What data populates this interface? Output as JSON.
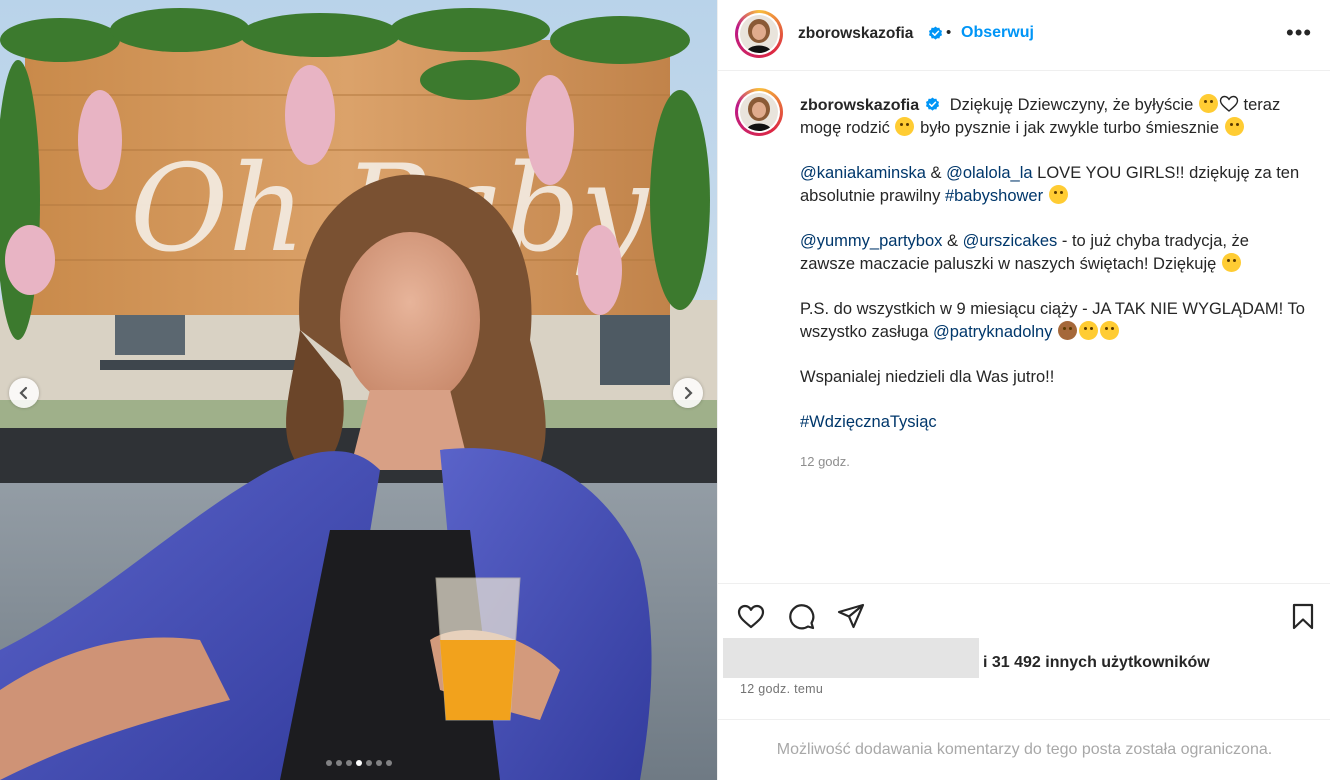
{
  "post": {
    "username": "zborowskazofia",
    "separator": "•",
    "follow_label": "Obserwuj",
    "more_label": "•••"
  },
  "media": {
    "sign_text": "Oh Baby",
    "slide_count": 7,
    "active_slide": 4
  },
  "caption": {
    "username": "zborowskazofia",
    "line1_a": "Dziękuję Dziewczyny, że byłyście",
    "line1_b": "teraz mogę rodzić",
    "line1_c": "było pysznie i jak zwykle turbo śmiesznie",
    "p2_mention1": "@kaniakaminska",
    "p2_amp": "&",
    "p2_mention2": "@olalola_la",
    "p2_text": "LOVE YOU GIRLS!! dziękuję za ten absolutnie prawilny",
    "p2_hashtag": "#babyshower",
    "p3_mention1": "@yummy_partybox",
    "p3_amp": "&",
    "p3_mention2": "@urszicakes",
    "p3_text": "- to już chyba tradycja, że zawsze maczacie paluszki w naszych świętach! Dziękuję",
    "p4_text": "P.S. do wszystkich w 9 miesiącu ciąży - JA TAK NIE WYGLĄDAM! To wszystko zasługa",
    "p4_mention": "@patryknadolny",
    "p5_text": "Wspanialej niedzieli dla Was jutro!!",
    "p6_hashtag": "#WdzięcznaTysiąc",
    "time": "12 godz."
  },
  "actions": {
    "likes_text": "i 31 492 innych użytkowników",
    "post_time": "12 godz. temu"
  },
  "comments": {
    "restricted_text": "Możliwość dodawania komentarzy do tego posta została ograniczona."
  },
  "colors": {
    "link": "#00376b",
    "follow": "#0095f6",
    "verified": "#0095f6"
  }
}
